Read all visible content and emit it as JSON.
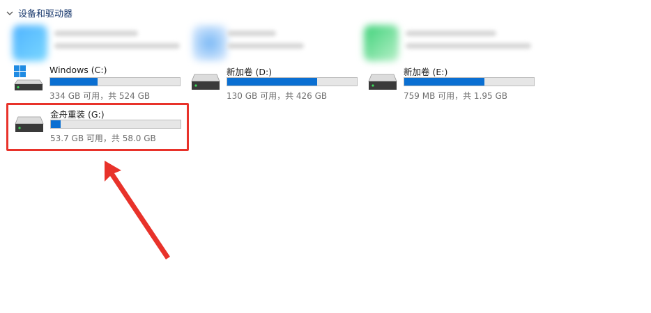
{
  "section": {
    "title": "设备和驱动器"
  },
  "drives": [
    {
      "name": "Windows (C:)",
      "info": "334 GB 可用，共 524 GB",
      "used_fraction": 0.363,
      "icon": "windows-drive-icon"
    },
    {
      "name": "新加卷 (D:)",
      "info": "130 GB 可用，共 426 GB",
      "used_fraction": 0.695,
      "icon": "hard-drive-icon"
    },
    {
      "name": "新加卷 (E:)",
      "info": "759 MB 可用，共 1.95 GB",
      "used_fraction": 0.62,
      "icon": "hard-drive-icon"
    },
    {
      "name": "金舟重装 (G:)",
      "info": "53.7 GB 可用，共 58.0 GB",
      "used_fraction": 0.074,
      "icon": "hard-drive-icon"
    }
  ],
  "colors": {
    "accent": "#0a6fd2",
    "annotation_red": "#e8322a"
  }
}
